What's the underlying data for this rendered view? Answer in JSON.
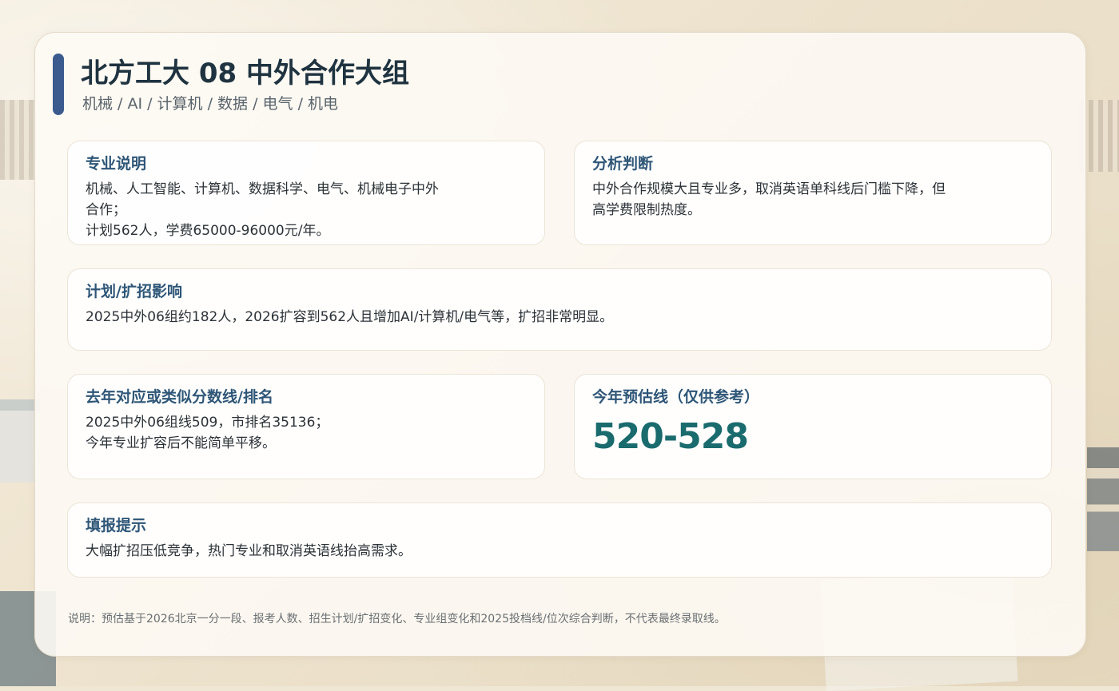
{
  "header": {
    "title": "北方工大 08 中外合作大组",
    "subtitle": "机械 / AI / 计算机 / 数据 / 电气 / 机电"
  },
  "cards": {
    "major": {
      "heading": "专业说明",
      "lines": [
        "机械、人工智能、计算机、数据科学、电气、机械电子中外",
        "合作；",
        "计划562人，学费65000-96000元/年。"
      ]
    },
    "analysis": {
      "heading": "分析判断",
      "lines": [
        "中外合作规模大且专业多，取消英语单科线后门槛下降，但",
        "高学费限制热度。"
      ]
    },
    "plan": {
      "heading": "计划/扩招影响",
      "lines": [
        "2025中外06组约182人，2026扩容到562人且增加AI/计算机/电气等，扩招非常明显。"
      ]
    },
    "last_year": {
      "heading": "去年对应或类似分数线/排名",
      "lines": [
        "2025中外06组线509，市排名35136；",
        "今年专业扩容后不能简单平移。"
      ]
    },
    "estimate": {
      "heading": "今年预估线（仅供参考）",
      "value": "520-528"
    },
    "tips": {
      "heading": "填报提示",
      "lines": [
        "大幅扩招压低竞争，热门专业和取消英语线抬高需求。"
      ]
    }
  },
  "footnote": "说明：预估基于2026北京一分一段、报考人数、招生计划/扩招变化、专业组变化和2025投档线/位次综合判断，不代表最终录取线。",
  "colors": {
    "accent_bar": "#3b5b8f",
    "heading": "#2e5677",
    "estimate_value": "#1a6b6e",
    "title": "#1f3340"
  }
}
